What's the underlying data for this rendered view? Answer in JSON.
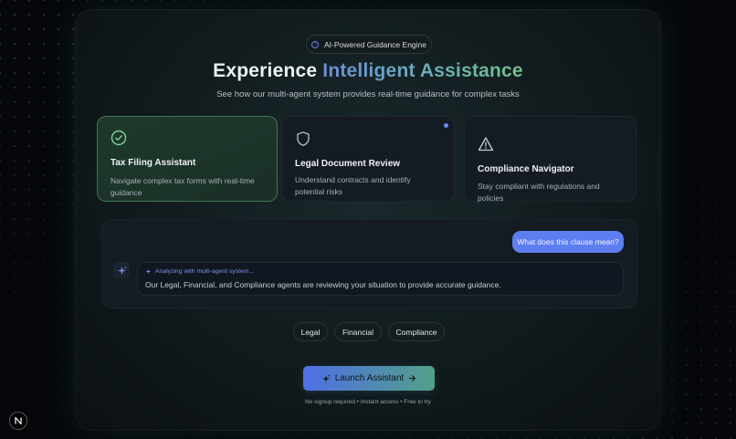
{
  "badge": {
    "label": "AI-Powered Guidance Engine",
    "icon": "info-circle-icon"
  },
  "hero": {
    "title_plain": "Experience",
    "title_highlight": "Intelligent Assistance",
    "subtitle": "See how our multi-agent system provides real-time guidance for complex tasks"
  },
  "cards": [
    {
      "title": "Tax Filing Assistant",
      "description": "Navigate complex tax forms with real-time guidance",
      "icon": "check-circle-icon",
      "active": true
    },
    {
      "title": "Legal Document Review",
      "description": "Understand contracts and identify potential risks",
      "icon": "shield-icon",
      "active": false
    },
    {
      "title": "Compliance Navigator",
      "description": "Stay compliant with regulations and policies",
      "icon": "warning-triangle-icon",
      "active": false
    }
  ],
  "chat": {
    "user_message": "What does this clause mean?",
    "agent_status": "Analyzing with multi-agent system...",
    "agent_message": "Our Legal, Financial, and Compliance agents are reviewing your situation to provide accurate guidance."
  },
  "tags": [
    "Legal",
    "Financial",
    "Compliance"
  ],
  "cta": {
    "label": "Launch Assistant",
    "icon": "sparkles-icon",
    "arrow_icon": "arrow-right-icon"
  },
  "footnote": "No signup required • Instant access • Free to try",
  "colors": {
    "accent_blue": "#5d7ef0",
    "accent_green": "#72c08a",
    "active_card_border": "#6ec88c",
    "background": "#05070a"
  }
}
